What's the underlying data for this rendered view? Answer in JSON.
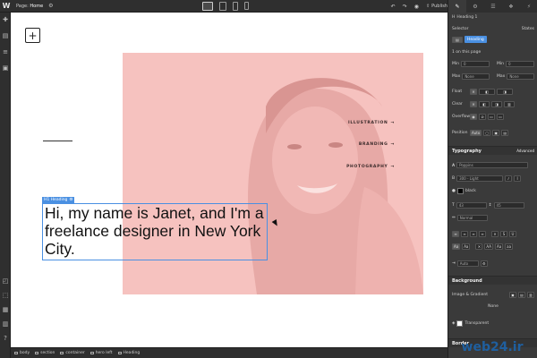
{
  "topbar": {
    "logo": "W",
    "page_prefix": "Page:",
    "page_name": "Home",
    "publish_label": "Publish"
  },
  "canvas": {
    "nav_links": [
      "ILLUSTRATION",
      "BRANDING",
      "PHOTOGRAPHY"
    ],
    "nav_arrow": "→",
    "heading_tag": "H1 Heading",
    "heading_text": "Hi, my name is Janet, and I'm a freelance designer in New York City."
  },
  "breadcrumbs": [
    "body",
    "section",
    "container",
    "hero left",
    "Heading"
  ],
  "panel": {
    "element_name": "Heading 1",
    "selector_label": "Selector",
    "states_label": "States",
    "selector_chip": "Heading",
    "on_page": "1 on this page",
    "min_w_label": "Min",
    "min_h_label": "Min",
    "max_label": "Max",
    "max_value": "None",
    "float_label": "Float",
    "clear_label": "Clear",
    "overflow_label": "Overflow",
    "position_label": "Position",
    "position_value": "Auto",
    "typography_title": "Typography",
    "advanced_label": "Advanced",
    "font_family": "Poppins",
    "font_weight": "300 - Light",
    "color_value": "black",
    "font_size": "43",
    "line_height": "45",
    "letter_spacing": "Normal",
    "text_indent": "Auto",
    "background_title": "Background",
    "image_gradient_label": "Image & Gradient",
    "image_value": "None",
    "bg_color_value": "Transparent",
    "border_title": "Border"
  },
  "watermark": "web24.ir",
  "colors": {
    "accent": "#4a90e2",
    "hero_pink": "#f6c2bf",
    "panel_bg": "#3a3a3a"
  }
}
